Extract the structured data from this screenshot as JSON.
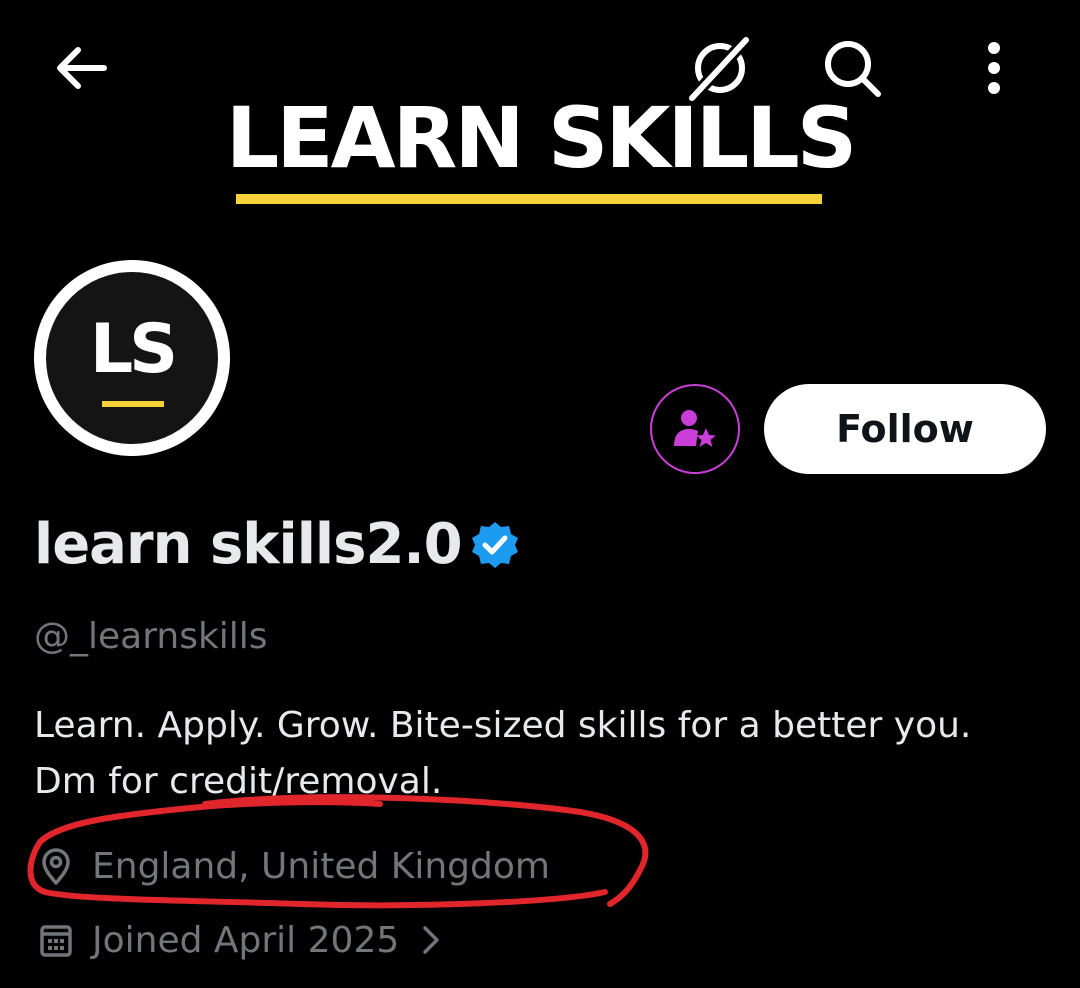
{
  "banner": {
    "title": "LEARN SKILLS",
    "accent_color": "#f7d23b"
  },
  "nav": {
    "back_icon": "arrow-left-icon",
    "grok_icon": "grok-icon",
    "search_icon": "search-icon",
    "more_icon": "more-vertical-icon"
  },
  "profile": {
    "avatar_text": "LS",
    "display_name": "learn skills2.0",
    "verified_color": "#1d9bf0",
    "handle": "@_learnskills",
    "bio_line1": "Learn. Apply. Grow. Bite-sized skills for a better you.",
    "bio_line2": "Dm for credit/removal.",
    "location": "England, United Kingdom",
    "joined": "Joined April 2025"
  },
  "actions": {
    "follow_label": "Follow",
    "subscribe_icon": "subscribe-star-person-icon",
    "subscribe_color": "#c83ed6"
  },
  "annotation": {
    "color": "#e0262b"
  }
}
